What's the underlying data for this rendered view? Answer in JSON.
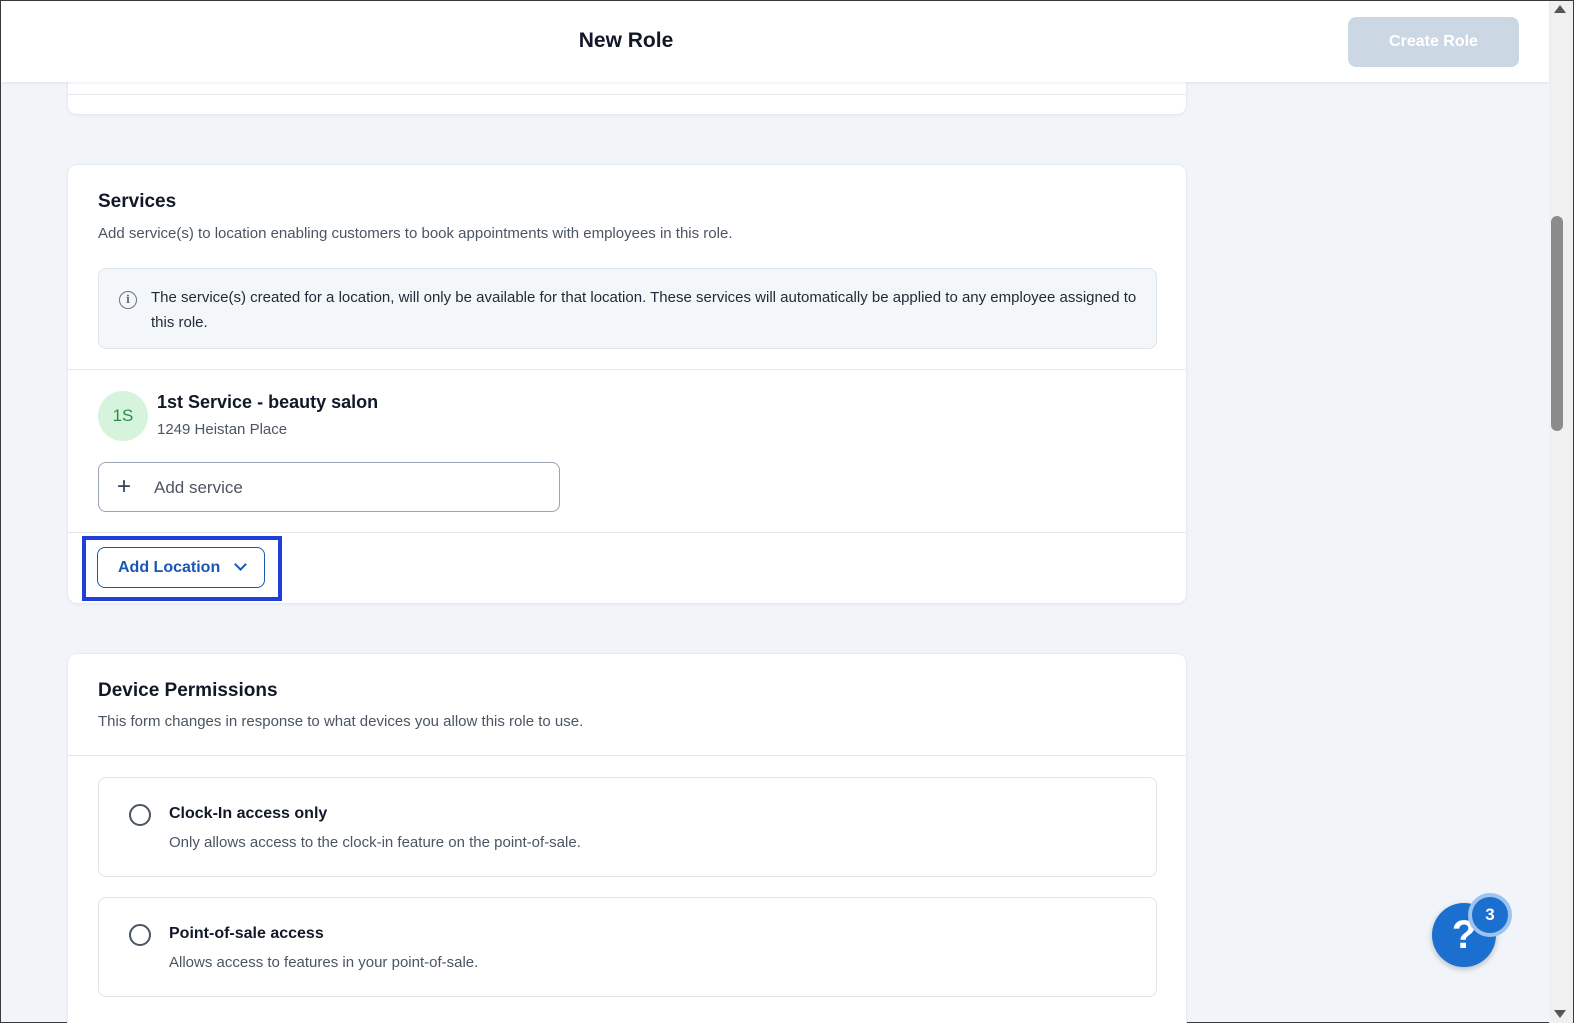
{
  "header": {
    "title": "New Role",
    "create_button": "Create Role"
  },
  "services": {
    "title": "Services",
    "description": "Add service(s) to location enabling customers to book appointments with employees in this role.",
    "info_text": "The service(s) created for a location, will only be available for that location. These services will automatically be applied to any employee assigned to this role.",
    "location": {
      "initials": "1S",
      "name": "1st Service - beauty salon",
      "address": "1249 Heistan Place"
    },
    "add_service_label": "Add service",
    "add_location_label": "Add Location"
  },
  "device_permissions": {
    "title": "Device Permissions",
    "description": "This form changes in response to what devices you allow this role to use.",
    "options": [
      {
        "title": "Clock-In access only",
        "description": "Only allows access to the clock-in feature on the point-of-sale.",
        "selected": false
      },
      {
        "title": "Point-of-sale access",
        "description": "Allows access to features in your point-of-sale.",
        "selected": false
      }
    ]
  },
  "help": {
    "icon_label": "?",
    "badge_count": "3"
  },
  "colors": {
    "primary": "#1a56b6",
    "highlight": "#1f3fd8",
    "page_bg": "#f1f5f9",
    "avatar_bg": "#d6f3dc"
  }
}
